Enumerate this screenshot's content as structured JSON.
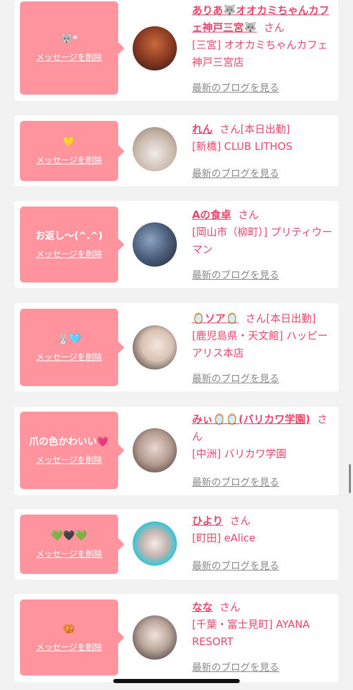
{
  "colors": {
    "accent": "#e8466a",
    "bubble": "#ff949f",
    "background": "#f2f2f2"
  },
  "delete_label": "メッセージを削除",
  "blog_label": "最新のブログを見る",
  "san": "さん",
  "items": [
    {
      "message": "🐺*",
      "name": "ありあ🐺オオカミちゃんカフェ神戸三宮🐺",
      "status": "",
      "shop": "[三宮] オオカミちゃんカフェ神戸三宮店",
      "avatar_icon": "avatar-photo"
    },
    {
      "message": "💛",
      "name": "れん",
      "status": "[本日出勤]",
      "shop": "[新橋] CLUB LITHOS",
      "avatar_icon": "avatar-photo"
    },
    {
      "message": "お返し〜(^.^)",
      "name": "Aの食卓",
      "status": "",
      "shop": "[岡山市（柳町）] プリティウーマン",
      "avatar_icon": "avatar-photo"
    },
    {
      "message": "🐰🩵",
      "name": "🪞ソア🪞",
      "status": "[本日出勤]",
      "shop": "[鹿児島県・天文館] ハッピーアリス本店",
      "avatar_icon": "avatar-photo"
    },
    {
      "message": "爪の色かわいい💗",
      "name": "みぃ🪞🪞(バリカワ学園)",
      "status": "",
      "shop": "[中洲] バリカワ学園",
      "avatar_icon": "avatar-photo"
    },
    {
      "message": "💚🖤💚",
      "name": "ひより",
      "status": "",
      "shop": "[町田] eAlice",
      "avatar_icon": "avatar-photo"
    },
    {
      "message": "🥨",
      "name": "なな",
      "status": "",
      "shop": "[千葉・富士見町] AYANA RESORT",
      "avatar_icon": "avatar-photo"
    }
  ]
}
